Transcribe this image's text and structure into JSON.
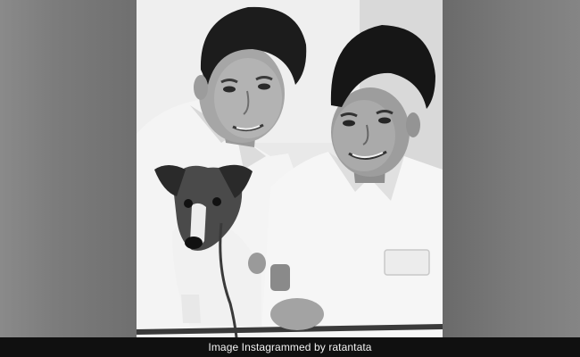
{
  "caption": {
    "text": "Image Instagrammed by ratantata"
  },
  "photo": {
    "style": "black-and-white",
    "subject_icons": [
      "boy-left",
      "boy-right",
      "puppy"
    ]
  },
  "colors": {
    "caption_bar": "#101010",
    "caption_text": "#f2f2f2"
  }
}
